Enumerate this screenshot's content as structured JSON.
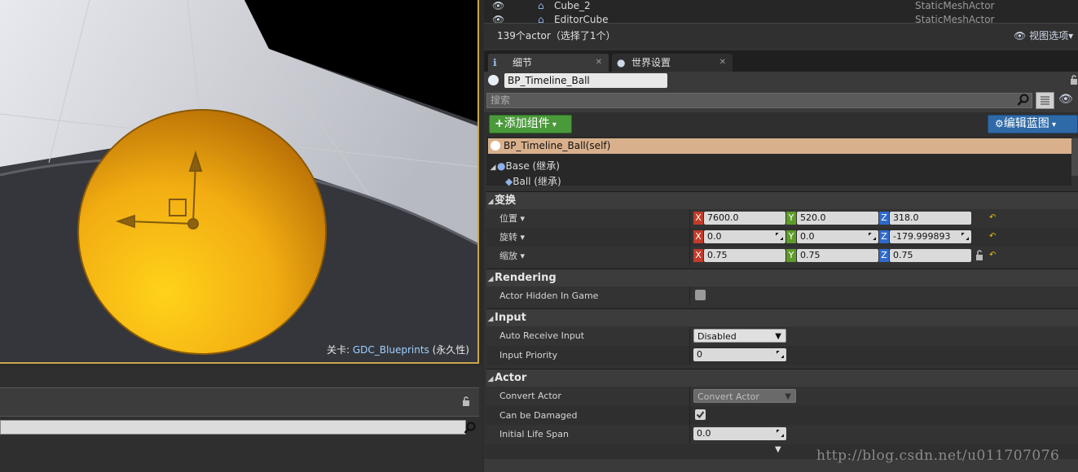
{
  "viewport": {
    "level_prefix": "关卡:",
    "level_name": "GDC_Blueprints",
    "level_suffix": "(永久性)"
  },
  "outliner": {
    "rows": [
      {
        "name": "Cube_2",
        "type": "StaticMeshActor"
      },
      {
        "name": "EditorCube",
        "type": "StaticMeshActor"
      }
    ],
    "status": "139个actor（选择了1个）",
    "view_options": "视图选项"
  },
  "tabs": [
    {
      "label": "细节"
    },
    {
      "label": "世界设置"
    }
  ],
  "details": {
    "actor_name": "BP_Timeline_Ball",
    "search_placeholder": "搜索",
    "add_component": "添加组件",
    "edit_blueprint": "编辑蓝图",
    "components": {
      "self": "BP_Timeline_Ball(self)",
      "base": "Base (继承)",
      "ball": "Ball (继承)"
    },
    "transform": {
      "title": "变换",
      "location": {
        "label": "位置",
        "x": "7600.0",
        "y": "520.0",
        "z": "318.0"
      },
      "rotation": {
        "label": "旋转",
        "x": "0.0",
        "y": "0.0",
        "z": "-179.999893"
      },
      "scale": {
        "label": "缩放",
        "x": "0.75",
        "y": "0.75",
        "z": "0.75"
      }
    },
    "rendering": {
      "title": "Rendering",
      "actor_hidden_label": "Actor Hidden In Game",
      "actor_hidden_checked": false
    },
    "input": {
      "title": "Input",
      "auto_receive_label": "Auto Receive Input",
      "auto_receive_value": "Disabled",
      "priority_label": "Input Priority",
      "priority_value": "0"
    },
    "actor": {
      "title": "Actor",
      "convert_label": "Convert Actor",
      "convert_value": "Convert Actor",
      "damaged_label": "Can be Damaged",
      "damaged_checked": true,
      "lifespan_label": "Initial Life Span",
      "lifespan_value": "0.0"
    }
  },
  "watermark": "http://blog.csdn.net/u011707076",
  "colors": {
    "selection": "#d8b08c",
    "add_button": "#4a9a3a",
    "edit_button": "#2f6aa8",
    "viewport_border": "#c8a64a"
  }
}
